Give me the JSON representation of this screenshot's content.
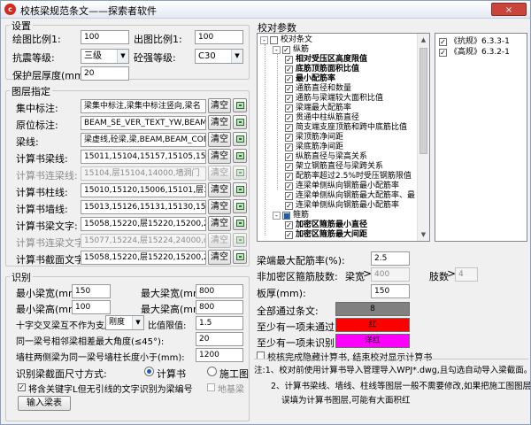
{
  "window": {
    "title": "校核梁规范条文——探索者软件",
    "close": "×"
  },
  "settings": {
    "title": "设置",
    "draw_scale_label": "绘图比例1:",
    "draw_scale": "100",
    "out_scale_label": "出图比例1:",
    "out_scale": "100",
    "seismic_label": "抗震等级:",
    "seismic": "三级",
    "concrete_label": "砼强等级:",
    "concrete": "C30",
    "cover_label": "保护层厚度(mm):",
    "cover": "20"
  },
  "layers": {
    "title": "图层指定",
    "clear": "清空",
    "rows": [
      {
        "label": "集中标注:",
        "value": "梁集中标注,梁集中标注竖向,梁名",
        "disabled": false
      },
      {
        "label": "原位标注:",
        "value": "BEAM_SE_VER_TEXT_YW,BEAM_SE_VE",
        "disabled": false
      },
      {
        "label": "梁线:",
        "value": "梁虚线,砼梁,梁,BEAM,BEAM_CON,B",
        "disabled": false
      },
      {
        "label": "计算书梁线:",
        "value": "15011,15104,15157,15105,15106,",
        "disabled": false
      },
      {
        "label": "计算书连梁线:",
        "value": "15104,层15104,14000,墙洞门",
        "disabled": true
      },
      {
        "label": "计算书柱线:",
        "value": "15010,15120,15006,15101,层1510",
        "disabled": false
      },
      {
        "label": "计算书墙线:",
        "value": "15013,15126,15131,15130,15103,",
        "disabled": false
      },
      {
        "label": "计算书梁文字:",
        "value": "15058,15220,层15220,15200,2100",
        "disabled": false
      },
      {
        "label": "计算书连梁文字:",
        "value": "15077,15224,层15224,24000,dspt",
        "disabled": true
      },
      {
        "label": "计算书截面文字:",
        "value": "15058,15220,层15220,15200,2100",
        "disabled": false
      }
    ]
  },
  "recog": {
    "title": "识别",
    "min_w_label": "最小梁宽(mm):",
    "min_w": "150",
    "max_w_label": "最大梁宽(mm):",
    "max_w": "800",
    "min_h_label": "最小梁高(mm):",
    "min_h": "100",
    "max_h_label": "最大梁高(mm):",
    "max_h": "800",
    "cross_label": "十字交叉梁互不作为支座",
    "cross_combo": "刚度",
    "ratio_label": "比值限值:",
    "ratio": "1.5",
    "angle_label": "同一梁号相邻梁相差最大角度(≤45°):",
    "angle": "20",
    "wall_label": "墙柱两侧梁为同一梁号墙柱长度小于(mm):",
    "wall": "1200",
    "size_label": "识别梁截面尺寸方式:",
    "opt_calc": "计算书",
    "opt_draw": "施工图",
    "opt_base": "地基梁",
    "no_key_label": "将含关键字L但无引线的文字识别为梁编号",
    "input_btn": "输入梁表"
  },
  "check": {
    "title": "校对参数",
    "tree": [
      {
        "level": 0,
        "text": "校对条文",
        "bold": false,
        "exp": "-",
        "check": ""
      },
      {
        "level": 1,
        "text": "纵筋",
        "bold": false,
        "exp": "-",
        "check": "✓"
      },
      {
        "level": 2,
        "text": "相对受压区高度限值",
        "bold": true,
        "check": "✓"
      },
      {
        "level": 2,
        "text": "底筋顶筋面积比值",
        "bold": true,
        "check": "✓"
      },
      {
        "level": 2,
        "text": "最小配筋率",
        "bold": true,
        "check": "✓"
      },
      {
        "level": 2,
        "text": "通筋直径和数量",
        "bold": false,
        "check": "✓"
      },
      {
        "level": 2,
        "text": "通筋与梁端较大面积比值",
        "bold": false,
        "check": "✓"
      },
      {
        "level": 2,
        "text": "梁端最大配筋率",
        "bold": false,
        "check": "✓"
      },
      {
        "level": 2,
        "text": "贯通中柱纵筋直径",
        "bold": false,
        "check": "✓"
      },
      {
        "level": 2,
        "text": "简支端支座顶筋和跨中底筋比值",
        "bold": false,
        "check": "✓"
      },
      {
        "level": 2,
        "text": "梁顶筋净间距",
        "bold": false,
        "check": "✓"
      },
      {
        "level": 2,
        "text": "梁底筋净间距",
        "bold": false,
        "check": "✓"
      },
      {
        "level": 2,
        "text": "纵筋直径与梁高关系",
        "bold": false,
        "check": "✓"
      },
      {
        "level": 2,
        "text": "架立钢筋直径与梁跨关系",
        "bold": false,
        "check": "✓"
      },
      {
        "level": 2,
        "text": "配筋率超过2.5%时受压钢筋限值",
        "bold": false,
        "check": "✓"
      },
      {
        "level": 2,
        "text": "连梁单侧纵向钢筋最小配筋率",
        "bold": false,
        "check": "✓"
      },
      {
        "level": 2,
        "text": "连梁单侧纵向钢筋最大配筋率、最",
        "bold": false,
        "check": "✓"
      },
      {
        "level": 2,
        "text": "连梁单侧纵向钢筋最小配筋率",
        "bold": false,
        "check": "✓"
      },
      {
        "level": 1,
        "text": "箍筋",
        "bold": false,
        "exp": "-",
        "check": "■"
      },
      {
        "level": 2,
        "text": "加密区箍筋最小直径",
        "bold": true,
        "check": "✓"
      },
      {
        "level": 2,
        "text": "加密区箍筋最大间距",
        "bold": true,
        "check": "✓"
      }
    ],
    "specs": [
      {
        "text": "《抗规》6.3.3-1",
        "check": "✓"
      },
      {
        "text": "《高规》6.3.2-1",
        "check": "✓"
      }
    ],
    "max_ratio_label": "梁端最大配筋率(%):",
    "max_ratio": "2.5",
    "stirrup_label": "非加密区箍筋肢数:",
    "beam_w_label": "梁宽",
    "beam_w": "400",
    "legs_label": "肢数",
    "legs": "4",
    "plate_label": "板厚(mm):",
    "plate": "150",
    "pass_label": "全部通过条文:",
    "pass_val": "8",
    "pass_color": "#808080",
    "fail_label": "至少有一项未通过:",
    "fail_val": "红",
    "fail_color": "#ff0000",
    "unrec_label": "至少有一项未识别:",
    "unrec_val": "洋红",
    "unrec_color": "#ff00ff",
    "finish_label": "校核完成隐藏计算书, 结束校对显示计算书"
  },
  "notes": {
    "n1": "注:1、校对前使用计算书导入管理导入WPJ*.dwg,且勾选自动导入梁截面。",
    "n2a": "2、计算书梁线、墙线、柱线等图层一般不需要修改,如果把施工图图层",
    "n2b": "误填为计算书图层,可能有大面积红"
  }
}
